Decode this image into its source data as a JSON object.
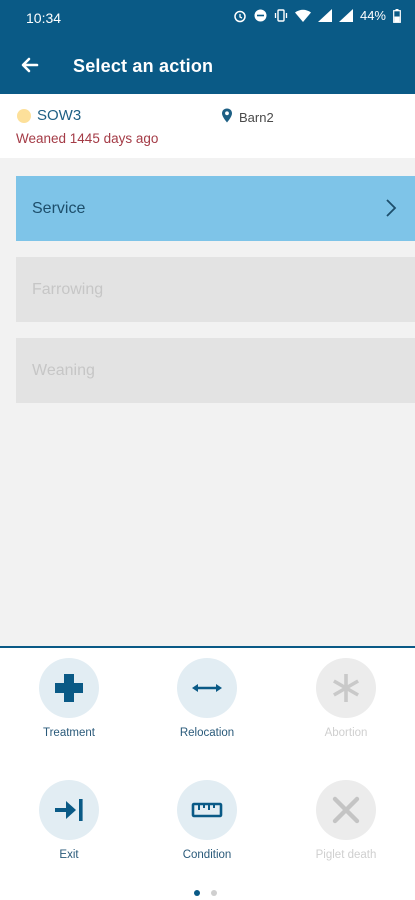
{
  "status_bar": {
    "time": "10:34",
    "battery": "44%"
  },
  "app_bar": {
    "title": "Select an action"
  },
  "animal": {
    "name": "SOW3",
    "weaned_text": "Weaned 1445 days ago",
    "location": "Barn2"
  },
  "actions": [
    {
      "label": "Service",
      "enabled": true
    },
    {
      "label": "Farrowing",
      "enabled": false
    },
    {
      "label": "Weaning",
      "enabled": false
    }
  ],
  "quick_actions": [
    {
      "label": "Treatment",
      "icon": "plus-icon",
      "enabled": true
    },
    {
      "label": "Relocation",
      "icon": "arrows-horizontal-icon",
      "enabled": true
    },
    {
      "label": "Abortion",
      "icon": "asterisk-icon",
      "enabled": false
    },
    {
      "label": "Exit",
      "icon": "exit-arrow-icon",
      "enabled": true
    },
    {
      "label": "Condition",
      "icon": "ruler-icon",
      "enabled": true
    },
    {
      "label": "Piglet death",
      "icon": "x-icon",
      "enabled": false
    }
  ],
  "pagination": {
    "current_page": 1,
    "total_pages": 2
  },
  "colors": {
    "primary": "#0a5a86",
    "selected_action": "#7ec4e8",
    "disabled_action": "#e3e3e3",
    "sow_dot": "#fde09a",
    "weaned_text": "#a43b46"
  }
}
